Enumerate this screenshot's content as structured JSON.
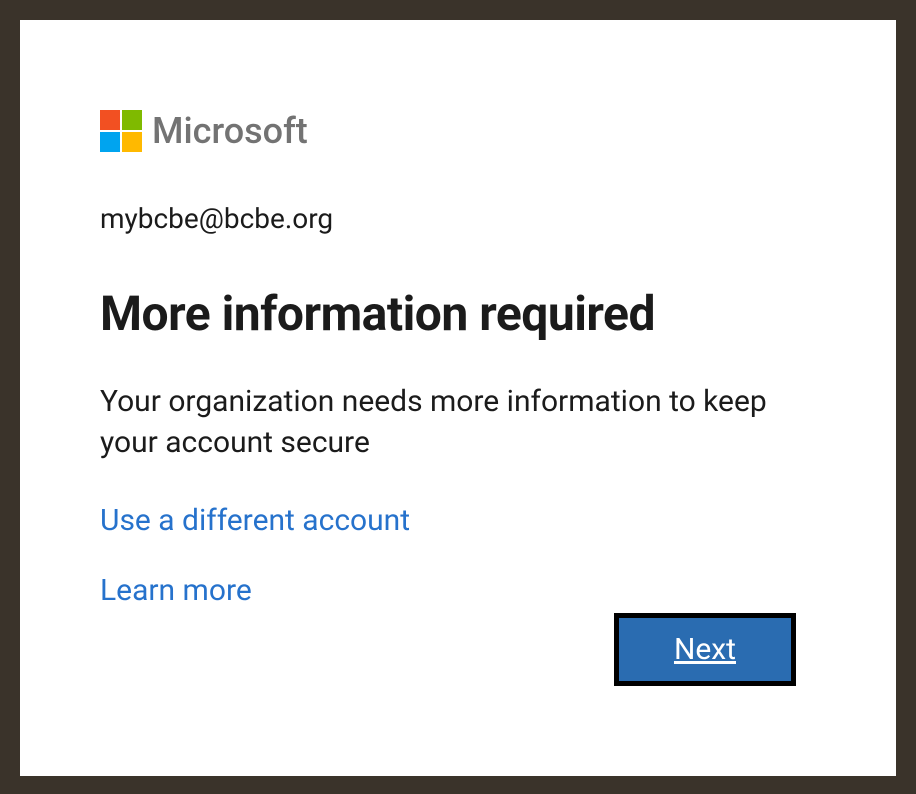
{
  "logo": {
    "brand_text": "Microsoft"
  },
  "account": {
    "email": "mybcbe@bcbe.org"
  },
  "heading": "More information required",
  "body": "Your organization needs more information to keep your account secure",
  "links": {
    "different_account": "Use a different account",
    "learn_more": "Learn more"
  },
  "buttons": {
    "next": "Next"
  }
}
